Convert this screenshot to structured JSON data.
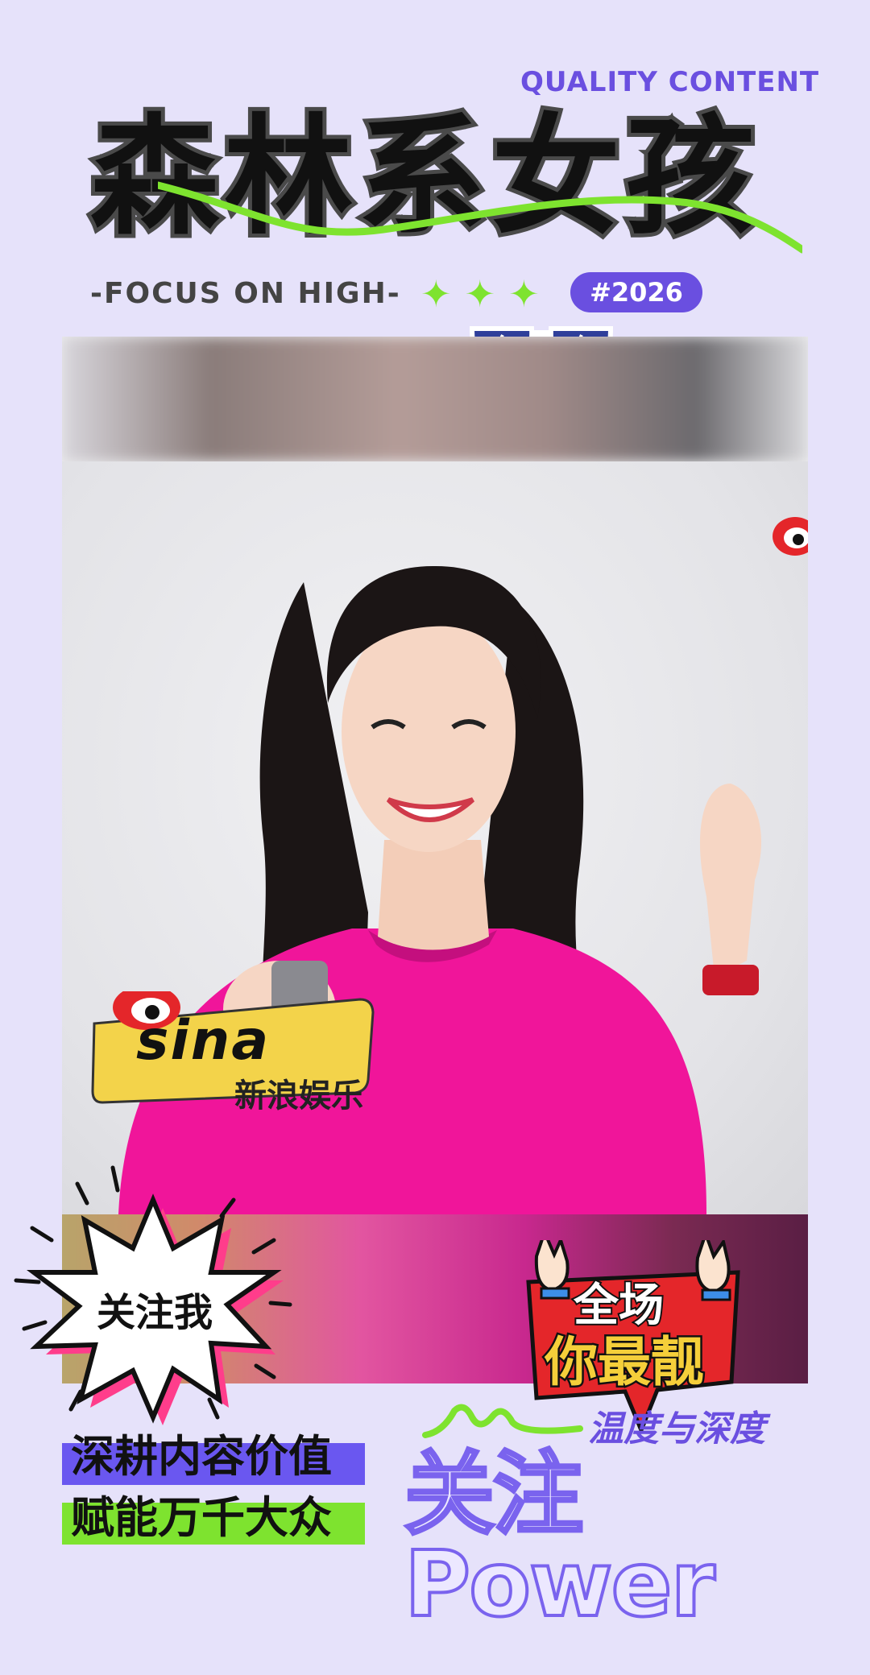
{
  "header": {
    "quality": "QUALITY CONTENT",
    "title": "森林系女孩",
    "focus": "-FOCUS ON HIGH-",
    "sparkles": "✦✦✦",
    "tag": "#2026"
  },
  "photo": {
    "logo_brand": "sina",
    "logo_sub": "新浪娱乐"
  },
  "overlay": {
    "follow_me": "关注我",
    "sticker_line1": "全场",
    "sticker_line2": "你最靓"
  },
  "footer": {
    "slogan1": "深耕内容价值",
    "slogan2": "赋能万千大众",
    "warmth": "温度与深度",
    "power": "关注Power"
  },
  "colors": {
    "background": "#e6e2fa",
    "accent_purple": "#6a4fe0",
    "accent_green": "#7ee32f",
    "shirt_pink": "#f0159a"
  },
  "icons": [
    "sunglasses-icon",
    "music-note-icon",
    "weibo-eye-icon",
    "sina-logo-icon",
    "burst-icon",
    "rock-hand-icon"
  ]
}
